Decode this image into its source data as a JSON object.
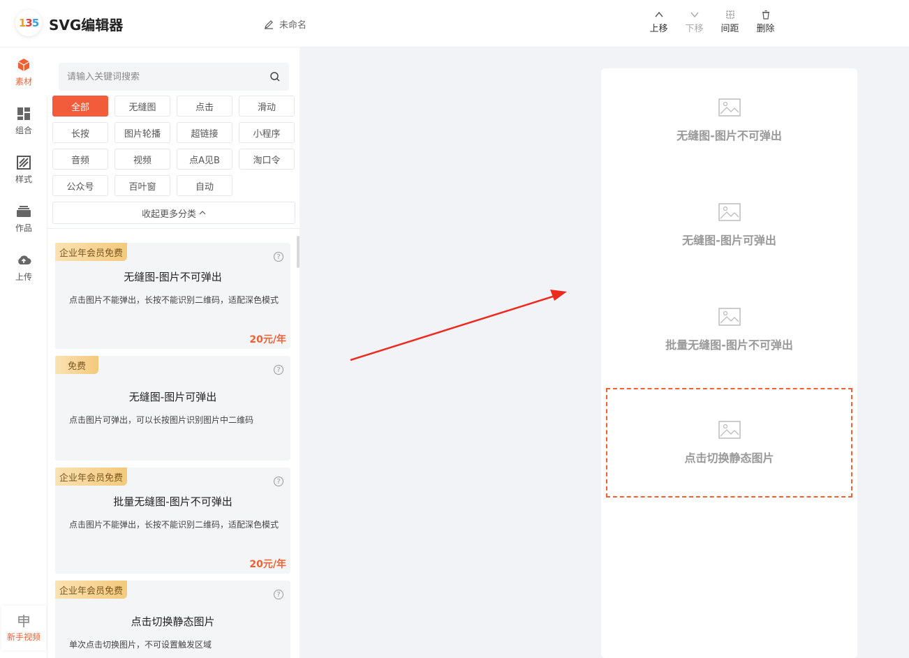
{
  "app": {
    "logo_text": "135",
    "title": "SVG编辑器",
    "doc_name": "未命名"
  },
  "toolbar": [
    {
      "label": "上移",
      "icon": "chevron-up-icon",
      "disabled": false
    },
    {
      "label": "下移",
      "icon": "chevron-down-icon",
      "disabled": true
    },
    {
      "label": "间距",
      "icon": "spacing-icon",
      "disabled": false
    },
    {
      "label": "删除",
      "icon": "trash-icon",
      "disabled": false
    }
  ],
  "rail": {
    "items": [
      {
        "label": "素材",
        "icon": "cube-icon",
        "active": true
      },
      {
        "label": "组合",
        "icon": "layout-icon",
        "active": false
      },
      {
        "label": "样式",
        "icon": "style-icon",
        "active": false
      },
      {
        "label": "作品",
        "icon": "layers-icon",
        "active": false
      },
      {
        "label": "上传",
        "icon": "cloud-upload-icon",
        "active": false
      }
    ],
    "bottom": {
      "label": "新手视频",
      "icon": "video-guide-icon"
    }
  },
  "search": {
    "placeholder": "请输入关键词搜索",
    "value": ""
  },
  "categories": [
    "全部",
    "无缝图",
    "点击",
    "滑动",
    "长按",
    "图片轮播",
    "超链接",
    "小程序",
    "音频",
    "视频",
    "点A见B",
    "淘口令",
    "公众号",
    "百叶窗",
    "自动"
  ],
  "active_category": "全部",
  "collapse_label": "收起更多分类",
  "cards": [
    {
      "badge": "企业年会员免费",
      "title": "无缝图-图片不可弹出",
      "desc": "点击图片不能弹出，长按不能识别二维码，适配深色模式",
      "price": "20元/年"
    },
    {
      "badge": "免费",
      "title": "无缝图-图片可弹出",
      "desc": "点击图片可弹出，可以长按图片识别图片中二维码",
      "price": ""
    },
    {
      "badge": "企业年会员免费",
      "title": "批量无缝图-图片不可弹出",
      "desc": "点击图片不能弹出，长按不能识别二维码，适配深色模式",
      "price": "20元/年"
    },
    {
      "badge": "企业年会员免费",
      "title": "点击切换静态图片",
      "desc": "单次点击切换图片，不可设置触发区域",
      "price": ""
    }
  ],
  "canvas_blocks": [
    {
      "label": "无缝图-图片不可弹出",
      "selected": false
    },
    {
      "label": "无缝图-图片可弹出",
      "selected": false
    },
    {
      "label": "批量无缝图-图片不可弹出",
      "selected": false
    },
    {
      "label": "点击切换静态图片",
      "selected": true
    }
  ],
  "colors": {
    "accent": "#f06033",
    "canvas_bg": "#f1f3f7",
    "card_bg": "#f4f5f7",
    "arrow": "#ee2a1e"
  }
}
